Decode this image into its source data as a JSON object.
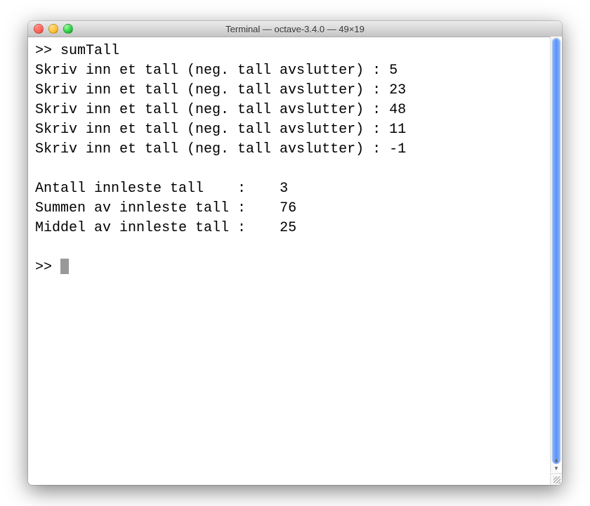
{
  "window": {
    "title": "Terminal — octave-3.4.0 — 49×19"
  },
  "terminal": {
    "prompt": ">>",
    "command": "sumTall",
    "input_prompt": "Skriv inn et tall (neg. tall avslutter) :",
    "inputs": [
      "5",
      "23",
      "48",
      "11",
      "-1"
    ],
    "results": [
      {
        "label": "Antall innleste tall    :",
        "value": "   3"
      },
      {
        "label": "Summen av innleste tall :",
        "value": "   76"
      },
      {
        "label": "Middel av innleste tall :",
        "value": "   25"
      }
    ]
  }
}
